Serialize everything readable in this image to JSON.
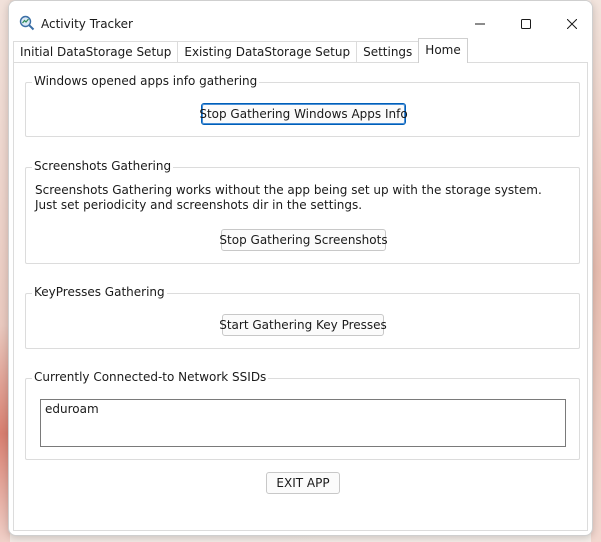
{
  "window": {
    "title": "Activity Tracker",
    "colors": {
      "focus_border": "#005fb8"
    }
  },
  "tabs": [
    {
      "label": "Initial DataStorage Setup",
      "active": false
    },
    {
      "label": "Existing DataStorage Setup",
      "active": false
    },
    {
      "label": "Settings",
      "active": false
    },
    {
      "label": "Home",
      "active": true
    }
  ],
  "sections": {
    "apps_info": {
      "label": "Windows opened apps info gathering",
      "button": "Stop Gathering Windows Apps Info"
    },
    "screenshots": {
      "label": "Screenshots Gathering",
      "desc_line1": "Screenshots Gathering works without the app being set up with the storage system.",
      "desc_line2": "Just set periodicity and screenshots dir in the settings.",
      "button": "Stop Gathering Screenshots"
    },
    "keypresses": {
      "label": "KeyPresses Gathering",
      "button": "Start Gathering Key Presses"
    },
    "ssids": {
      "label": "Currently Connected-to Network SSIDs",
      "items": [
        "eduroam"
      ]
    }
  },
  "exit_button": "EXIT APP"
}
